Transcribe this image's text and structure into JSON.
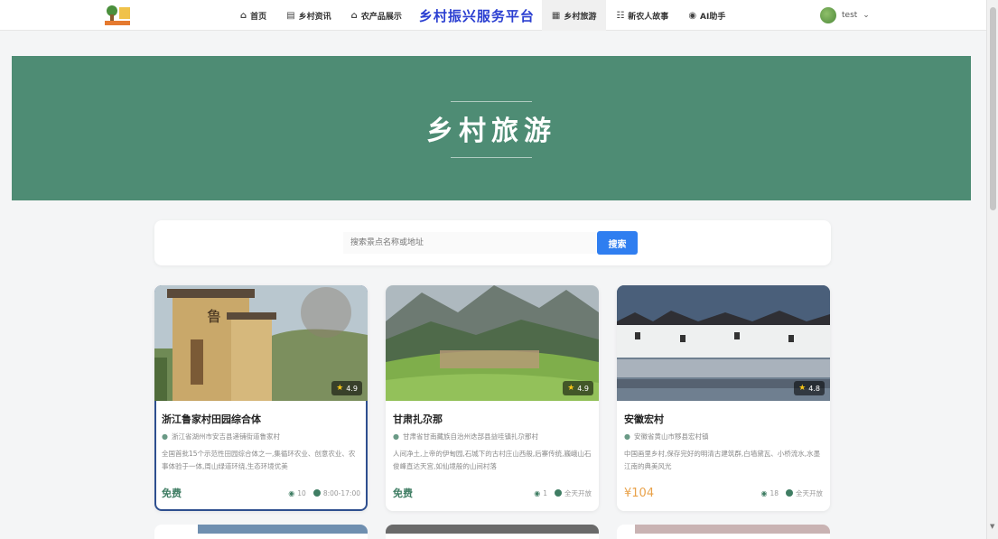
{
  "nav": {
    "items": [
      {
        "label": "首页",
        "icon": "home-icon"
      },
      {
        "label": "乡村资讯",
        "icon": "newspaper-icon"
      },
      {
        "label": "农产品展示",
        "icon": "shop-icon"
      }
    ],
    "brand": "乡村振兴服务平台",
    "items_right": [
      {
        "label": "乡村旅游",
        "icon": "map-icon",
        "active": true
      },
      {
        "label": "新农人故事",
        "icon": "people-icon"
      },
      {
        "label": "AI助手",
        "icon": "robot-icon"
      }
    ],
    "user": {
      "name": "test"
    }
  },
  "hero": {
    "title": "乡村旅游"
  },
  "search": {
    "placeholder": "搜索景点名称或地址",
    "button_label": "搜索"
  },
  "cards": [
    {
      "title": "浙江鲁家村田园综合体",
      "location": "浙江省湖州市安吉县递铺街道鲁家村",
      "description": "全国首批15个示范性田园综合体之一,集循环农业、创意农业、农事体验于一体,周山绿道环绕,生态环境优美",
      "rating": "4.9",
      "price": "免费",
      "views": "10",
      "hours": "8:00-17:00"
    },
    {
      "title": "甘肃扎尕那",
      "location": "甘肃省甘南藏族自治州迭部县益哇镇扎尕那村",
      "description": "人间净土,上帝的伊甸园,石城下的古村庄山西般,后寨传统,巍峨山石俊峰直达天宫,如仙境般的山间村落",
      "rating": "4.9",
      "price": "免费",
      "views": "1",
      "hours": "全天开放"
    },
    {
      "title": "安徽宏村",
      "location": "安徽省黄山市黟县宏村镇",
      "description": "中国画里乡村,保存完好的明清古建筑群,白墙黛瓦、小桥流水,水墨江南的典美风光",
      "rating": "4.8",
      "price": "¥104",
      "views": "18",
      "hours": "全天开放"
    }
  ]
}
